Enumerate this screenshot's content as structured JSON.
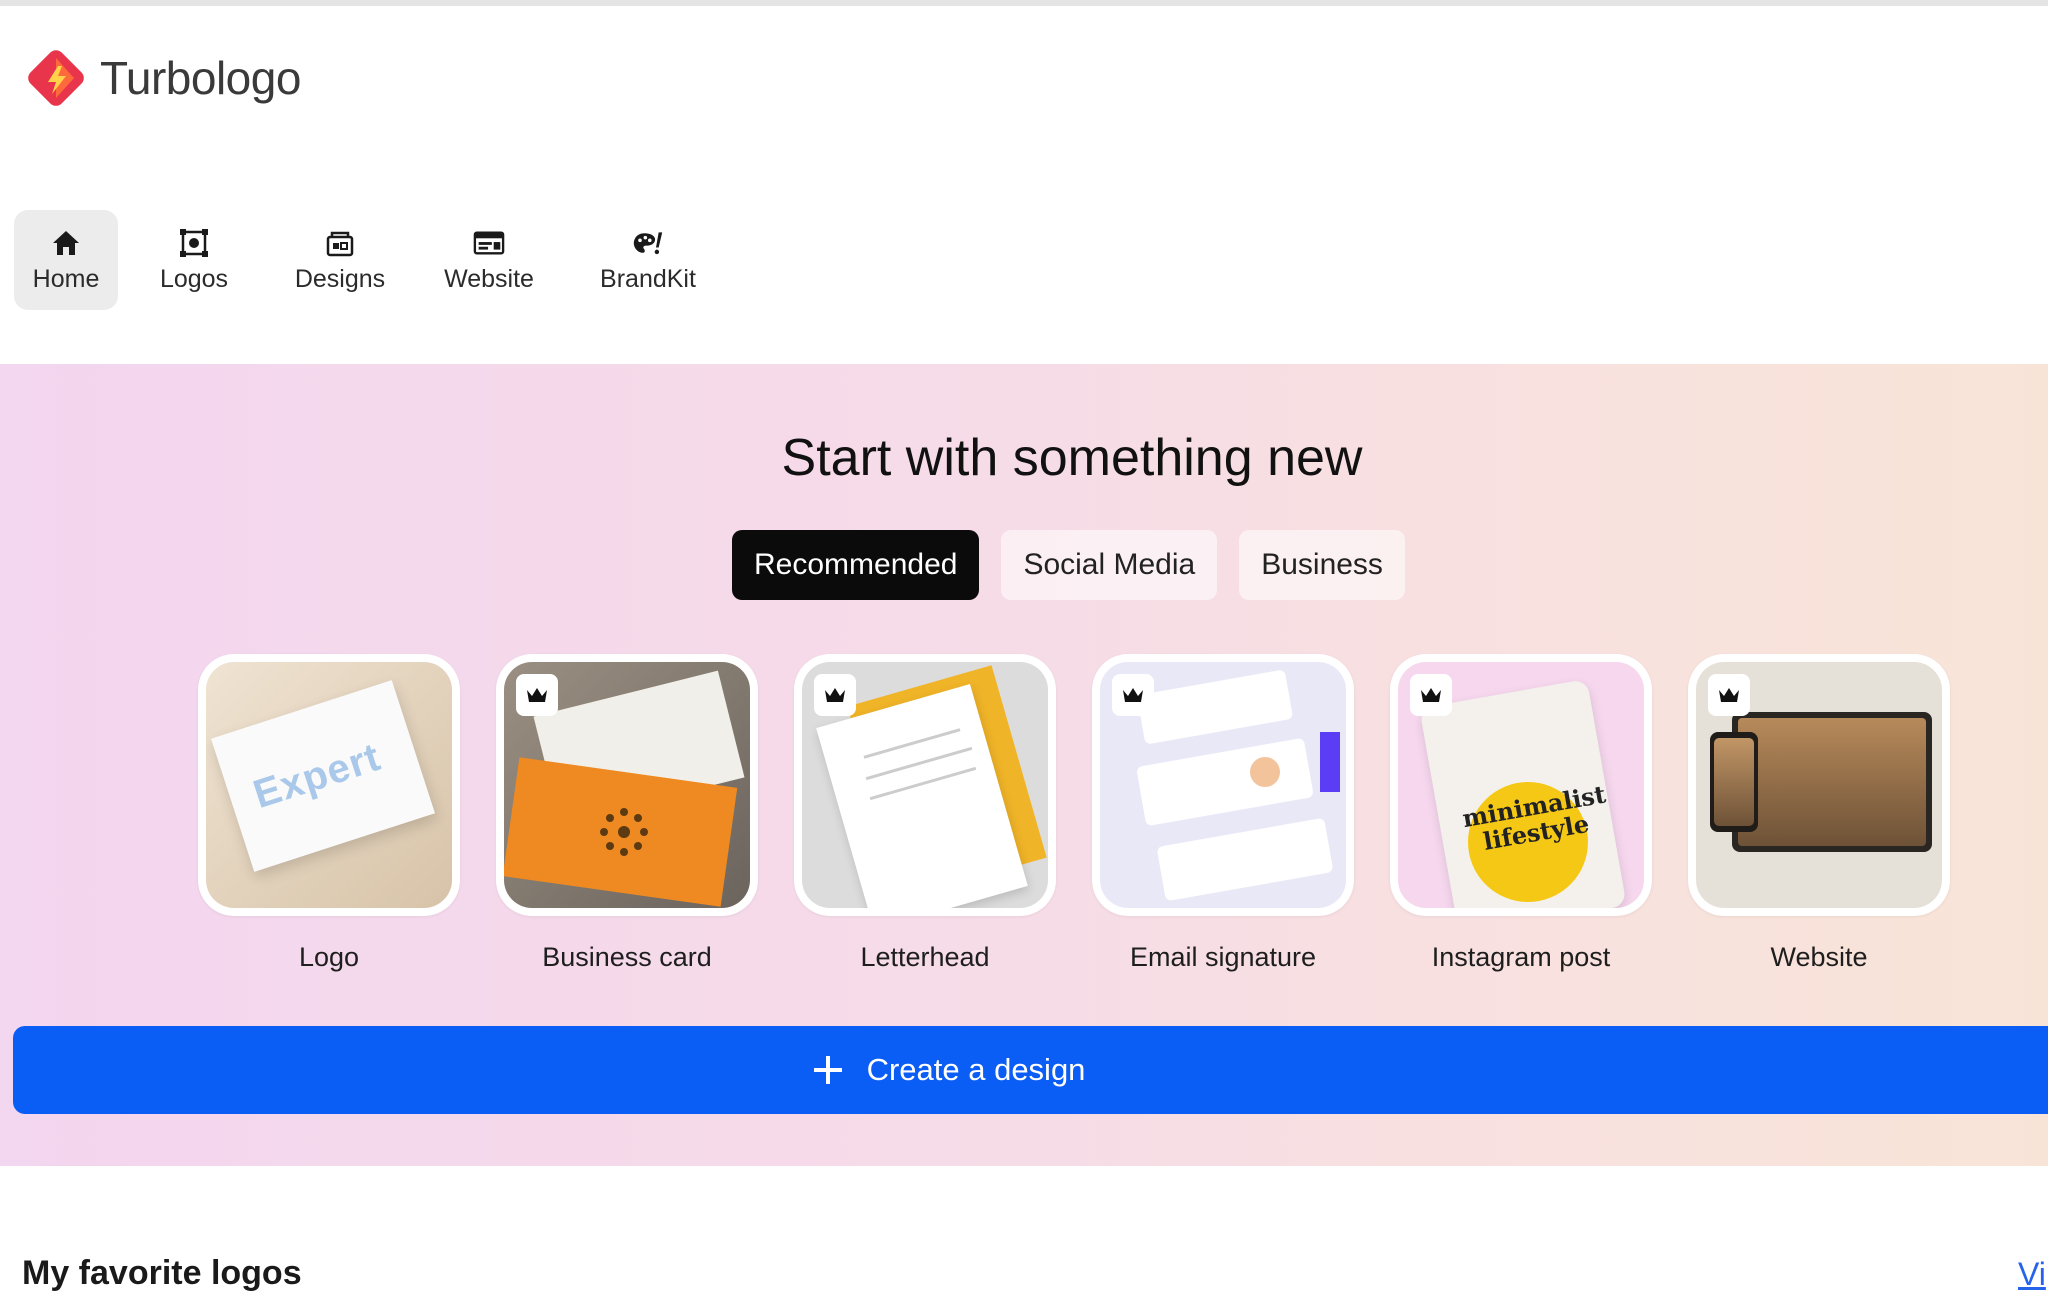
{
  "brand": {
    "name": "Turbologo",
    "logo_icon": "turbologo-logo-icon",
    "colors": [
      "#e8354b",
      "#f5a623",
      "#ff6a3d"
    ]
  },
  "nav": [
    {
      "label": "Home",
      "icon": "home-icon",
      "active": true
    },
    {
      "label": "Logos",
      "icon": "logos-icon",
      "active": false
    },
    {
      "label": "Designs",
      "icon": "designs-icon",
      "active": false
    },
    {
      "label": "Website",
      "icon": "website-icon",
      "active": false
    },
    {
      "label": "BrandKit",
      "icon": "brandkit-icon",
      "active": false
    }
  ],
  "hero": {
    "title": "Start with something new",
    "tabs": [
      {
        "label": "Recommended",
        "active": true
      },
      {
        "label": "Social Media",
        "active": false
      },
      {
        "label": "Business",
        "active": false
      }
    ],
    "cards": [
      {
        "label": "Logo",
        "premium": false,
        "icon": "logo-mockup-thumbnail",
        "thumb_text": "Expert"
      },
      {
        "label": "Business card",
        "premium": true,
        "icon": "business-card-thumbnail"
      },
      {
        "label": "Letterhead",
        "premium": true,
        "icon": "letterhead-thumbnail"
      },
      {
        "label": "Email signature",
        "premium": true,
        "icon": "email-signature-thumbnail"
      },
      {
        "label": "Instagram post",
        "premium": true,
        "icon": "instagram-post-thumbnail",
        "thumb_text": "minimalist lifestyle"
      },
      {
        "label": "Website",
        "premium": true,
        "icon": "website-thumbnail"
      }
    ],
    "create_button": {
      "label": "Create a design",
      "icon": "plus-icon"
    }
  },
  "favorites": {
    "title": "My favorite logos",
    "link": "Vi"
  },
  "colors": {
    "accent": "#0a5df5",
    "active_tab": "#0b0b0b",
    "link": "#2563eb"
  }
}
